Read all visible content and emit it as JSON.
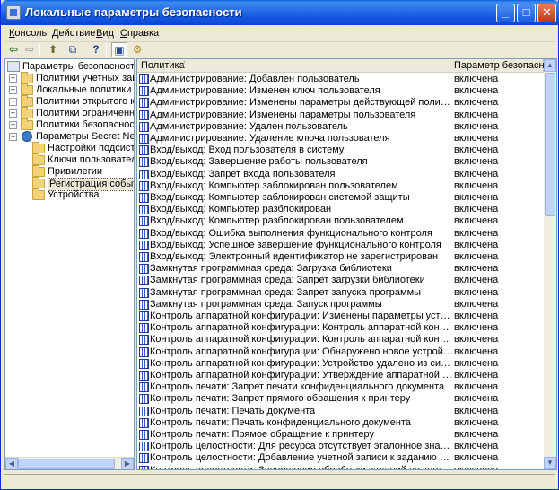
{
  "window": {
    "title": "Локальные параметры безопасности",
    "min_glyph": "_",
    "max_glyph": "□",
    "close_glyph": "✕"
  },
  "menu": [
    {
      "pre": "",
      "accel": "К",
      "post": "онсоль"
    },
    {
      "pre": "",
      "accel": "Д",
      "post": "ействие"
    },
    {
      "pre": "",
      "accel": "В",
      "post": "ид"
    },
    {
      "pre": "",
      "accel": "С",
      "post": "правка"
    }
  ],
  "toolbar": {
    "back_glyph": "⇦",
    "forward_glyph": "⇨",
    "up_glyph": "⬆",
    "export_glyph": "⧉",
    "help_glyph": "?",
    "window_glyph": "▣",
    "properties_glyph": "⚙"
  },
  "tree": {
    "root": "Параметры безопасности",
    "items": [
      {
        "label": "Политики учетных записей",
        "expander": "+"
      },
      {
        "label": "Локальные политики",
        "expander": "+"
      },
      {
        "label": "Политики открытого ключа",
        "expander": "+"
      },
      {
        "label": "Политики ограниченного ис",
        "expander": "+"
      },
      {
        "label": "Политики безопасности IP н",
        "expander": "+"
      },
      {
        "label": "Параметры Secret Net",
        "expander": "−"
      }
    ],
    "children": [
      {
        "label": "Настройки подсистем"
      },
      {
        "label": "Ключи пользователя"
      },
      {
        "label": "Привилегии"
      },
      {
        "label": "Регистрация событий"
      },
      {
        "label": "Устройства"
      }
    ]
  },
  "list": {
    "col_policy": "Политика",
    "col_param": "Параметр безопасности",
    "rows": [
      {
        "name": "Администрирование: Добавлен пользователь",
        "value": "включена"
      },
      {
        "name": "Администрирование: Изменен ключ пользователя",
        "value": "включена"
      },
      {
        "name": "Администрирование: Изменены параметры действующей политики безопасности",
        "value": "включена"
      },
      {
        "name": "Администрирование: Изменены параметры пользователя",
        "value": "включена"
      },
      {
        "name": "Администрирование: Удален пользователь",
        "value": "включена"
      },
      {
        "name": "Администрирование: Удаление ключа пользователя",
        "value": "включена"
      },
      {
        "name": "Вход/выход: Вход пользователя в систему",
        "value": "включена"
      },
      {
        "name": "Вход/выход: Завершение работы пользователя",
        "value": "включена"
      },
      {
        "name": "Вход/выход: Запрет входа пользователя",
        "value": "включена"
      },
      {
        "name": "Вход/выход: Компьютер заблокирован пользователем",
        "value": "включена"
      },
      {
        "name": "Вход/выход: Компьютер заблокирован системой защиты",
        "value": "включена"
      },
      {
        "name": "Вход/выход: Компьютер разблокирован",
        "value": "включена"
      },
      {
        "name": "Вход/выход: Компьютер разблокирован пользователем",
        "value": "включена"
      },
      {
        "name": "Вход/выход: Ошибка выполнения функционального контроля",
        "value": "включена"
      },
      {
        "name": "Вход/выход: Успешное завершение функционального контроля",
        "value": "включена"
      },
      {
        "name": "Вход/выход: Электронный идентификатор не зарегистрирован",
        "value": "включена"
      },
      {
        "name": "Замкнутая программная среда: Загрузка библиотеки",
        "value": "включена"
      },
      {
        "name": "Замкнутая программная среда: Запрет загрузки библиотеки",
        "value": "включена"
      },
      {
        "name": "Замкнутая программная среда: Запрет запуска программы",
        "value": "включена"
      },
      {
        "name": "Замкнутая программная среда: Запуск программы",
        "value": "включена"
      },
      {
        "name": "Контроль аппаратной конфигурации: Изменены параметры устройства",
        "value": "включена"
      },
      {
        "name": "Контроль аппаратной конфигурации: Контроль аппаратной конфигурации заверш...",
        "value": "включена"
      },
      {
        "name": "Контроль аппаратной конфигурации: Контроль аппаратной конфигурации успе...",
        "value": "включена"
      },
      {
        "name": "Контроль аппаратной конфигурации: Обнаружено новое устройство",
        "value": "включена"
      },
      {
        "name": "Контроль аппаратной конфигурации: Устройство удалено из системы",
        "value": "включена"
      },
      {
        "name": "Контроль аппаратной конфигурации: Утверждение аппаратной конфигурации к...",
        "value": "включена"
      },
      {
        "name": "Контроль печати: Запрет печати конфиденциального документа",
        "value": "включена"
      },
      {
        "name": "Контроль печати: Запрет прямого обращения к принтеру",
        "value": "включена"
      },
      {
        "name": "Контроль печати: Печать документа",
        "value": "включена"
      },
      {
        "name": "Контроль печати: Печать конфиденциального документа",
        "value": "включена"
      },
      {
        "name": "Контроль печати: Прямое обращение к принтеру",
        "value": "включена"
      },
      {
        "name": "Контроль целостности: Для ресурса отсутствует эталонное значение",
        "value": "включена"
      },
      {
        "name": "Контроль целостности: Добавление учетной записи к заданию ЗПС",
        "value": "включена"
      },
      {
        "name": "Контроль целостности: Завершение обработки заданий на контроль целостности",
        "value": "включена"
      }
    ]
  }
}
